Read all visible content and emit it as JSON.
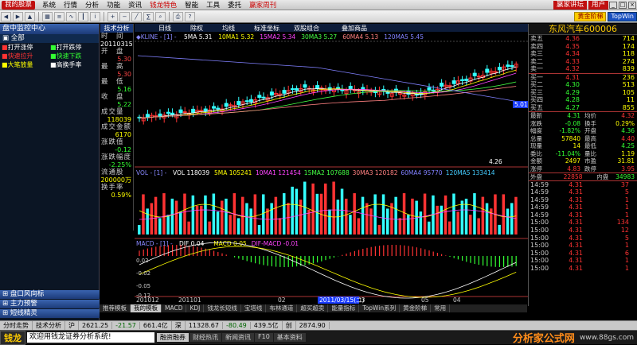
{
  "menubar": {
    "logo": "我的股票",
    "items": [
      "系统",
      "行情",
      "分析",
      "功能",
      "资讯",
      "钱龙特色",
      "智能",
      "工具",
      "委托",
      "赢家周刊"
    ],
    "right_buttons": [
      "赢家讲坛",
      "用户"
    ]
  },
  "toolbar": {
    "yellow_btn": "黄金阶梯",
    "blue_btn": "TopWin"
  },
  "sidebar": {
    "title": "盘中监控中心",
    "all_label": "全部",
    "signals": [
      [
        "打开涨停",
        "打开跌停"
      ],
      [
        "快速拉升",
        "快速下跌"
      ],
      [
        "大笔放量",
        "高换手率"
      ]
    ],
    "sections": [
      "盘口风向标",
      "主力预警",
      "短线精灵"
    ]
  },
  "infopanel": {
    "tab": "技术分析",
    "time_label": "时　间",
    "time_value": "20110315",
    "open_label": "开　盘",
    "open_value": "5.30",
    "high_label": "最　高",
    "high_value": "5.30",
    "low_label": "最　低",
    "low_value": "5.16",
    "close_label": "收　盘",
    "close_value": "5.22",
    "vol_label": "成交量",
    "vol_value": "118039",
    "amount_label": "成交金额",
    "amount_value": "6170",
    "change_label": "涨跌值",
    "change_value": "-0.12",
    "pct_label": "涨跌幅度",
    "pct_value": "-2.25%",
    "float_label": "流通股",
    "float_value": "200000万",
    "turnover_label": "换手率",
    "turnover_value": "0.59%"
  },
  "chart": {
    "tabs": [
      "日线",
      "除权",
      "均线",
      "标准坐标",
      "双股组合",
      "叠加商品"
    ],
    "kline_label": "◆KLINE - [1] -",
    "ma_labels": [
      {
        "t": "5MA 5.31",
        "c": "#ffffff"
      },
      {
        "t": "10MA1 5.32",
        "c": "#ffff00"
      },
      {
        "t": "15MA2 5.34",
        "c": "#ff44ff"
      },
      {
        "t": "30MA3 5.27",
        "c": "#44ff44"
      },
      {
        "t": "60MA4 5.13",
        "c": "#ff8080"
      },
      {
        "t": "120MA5 5.45",
        "c": "#8080ff"
      }
    ],
    "price_ticks": [
      "5.50",
      "5.00",
      "4.50"
    ],
    "price_marker": "5.01",
    "low_label": "4.26",
    "vol_label": "VOL - [1] -",
    "vol_items": [
      {
        "t": "VOL 118039",
        "c": "#ffffff"
      },
      {
        "t": "5MA 105241",
        "c": "#ffff00"
      },
      {
        "t": "10MA1 121454",
        "c": "#ff44ff"
      },
      {
        "t": "15MA2 107688",
        "c": "#44ff44"
      },
      {
        "t": "30MA3 120182",
        "c": "#ff8080"
      },
      {
        "t": "60MA4 95770",
        "c": "#8080ff"
      },
      {
        "t": "120MA5 133414",
        "c": "#44ccff"
      }
    ],
    "macd_label": "MACD - [1] -",
    "macd_items": [
      {
        "t": "DIF 0.04",
        "c": "#ffffff"
      },
      {
        "t": "MACD 0.05",
        "c": "#ffff00"
      },
      {
        "t": "DIF-MACD -0.01",
        "c": "#ff44ff"
      }
    ],
    "macd_ticks": [
      "0.02",
      "-0.02",
      "-0.05",
      "-0.12",
      "-0.19"
    ],
    "date_labels": [
      "201012",
      "201101",
      "02",
      "03",
      "04",
      "05"
    ],
    "cursor_date": "2011/03/15(二)"
  },
  "tabbar": [
    "推荐模板",
    "我的模板",
    "MACD",
    "KDJ",
    "钱龙长短线",
    "宝塔线",
    "布林通道",
    "超买超卖",
    "能量指标",
    "TopWin系列",
    "黄金阶梯",
    "常用"
  ],
  "rpanel": {
    "name": "东风汽车",
    "code": "600006",
    "asks": [
      [
        "卖五",
        "4.36",
        "714"
      ],
      [
        "卖四",
        "4.35",
        "174"
      ],
      [
        "卖三",
        "4.34",
        "118"
      ],
      [
        "卖二",
        "4.33",
        "274"
      ],
      [
        "卖一",
        "4.32",
        "839"
      ]
    ],
    "bids": [
      [
        "买一",
        "4.31",
        "236"
      ],
      [
        "买二",
        "4.30",
        "513"
      ],
      [
        "买三",
        "4.29",
        "105"
      ],
      [
        "买四",
        "4.28",
        "11"
      ],
      [
        "买五",
        "4.27",
        "855"
      ]
    ],
    "quote": [
      [
        [
          "最新",
          "4.31"
        ],
        [
          "均价",
          "4.32"
        ]
      ],
      [
        [
          "涨跌",
          "-0.08"
        ],
        [
          "换手",
          "0.29%"
        ]
      ],
      [
        [
          "幅度",
          "-1.82%"
        ],
        [
          "开盘",
          "4.36"
        ]
      ],
      [
        [
          "总量",
          "57840"
        ],
        [
          "最高",
          "4.40"
        ]
      ],
      [
        [
          "现量",
          "14"
        ],
        [
          "最低",
          "4.25"
        ]
      ],
      [
        [
          "委比",
          "-11.04%"
        ],
        [
          "量比",
          "1.19"
        ]
      ],
      [
        [
          "金额",
          "2497"
        ],
        [
          "市盈",
          "31.81"
        ]
      ],
      [
        [
          "涨停",
          "4.83"
        ],
        [
          "跌停",
          "3.95"
        ]
      ]
    ],
    "outer_label": "外盘",
    "outer_value": "22858",
    "inner_label": "内盘",
    "inner_value": "34983",
    "ticks": [
      [
        "14:59",
        "4.31",
        "37"
      ],
      [
        "14:59",
        "4.31",
        "5"
      ],
      [
        "14:59",
        "4.31",
        "1"
      ],
      [
        "14:59",
        "4.31",
        "1"
      ],
      [
        "14:59",
        "4.31",
        "1"
      ],
      [
        "15:00",
        "4.31",
        "134"
      ],
      [
        "15:00",
        "4.31",
        "12"
      ],
      [
        "15:00",
        "4.31",
        "5"
      ],
      [
        "15:00",
        "4.31",
        "1"
      ],
      [
        "15:00",
        "4.31",
        "6"
      ],
      [
        "15:00",
        "4.31",
        "1"
      ],
      [
        "15:00",
        "4.31",
        "1"
      ]
    ]
  },
  "statusbar": {
    "items": [
      {
        "t": "分时走势",
        "c": ""
      },
      {
        "t": "技术分析",
        "c": ""
      },
      {
        "t": "沪",
        "c": ""
      },
      {
        "t": "2621.25",
        "c": ""
      },
      {
        "t": "-21.57",
        "c": "g"
      },
      {
        "t": "661.4亿",
        "c": ""
      },
      {
        "t": "深",
        "c": ""
      },
      {
        "t": "11328.67",
        "c": ""
      },
      {
        "t": "-80.49",
        "c": "g"
      },
      {
        "t": "439.5亿",
        "c": ""
      },
      {
        "t": "创",
        "c": ""
      },
      {
        "t": "2874.90",
        "c": ""
      }
    ]
  },
  "bottombar": {
    "logo": "钱龙",
    "ticker": "欢迎用钱龙证券分析系统!",
    "tabs": [
      "融资融券",
      "财经热讯",
      "新闻资讯",
      "F10",
      "基本资料"
    ],
    "brand": "分析家公式网",
    "url": "www.88gs.com"
  }
}
